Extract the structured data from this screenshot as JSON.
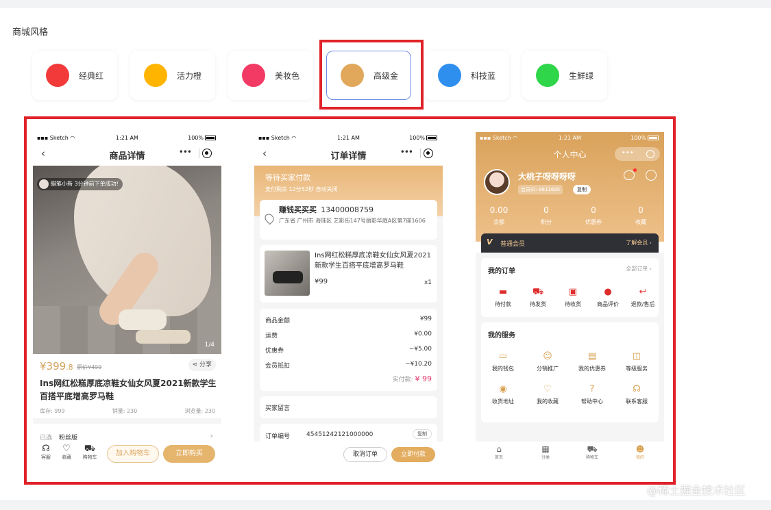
{
  "section_title": "商城风格",
  "themes": [
    {
      "label": "经典红",
      "color": "#f23a3a"
    },
    {
      "label": "活力橙",
      "color": "#ffb400"
    },
    {
      "label": "美妆色",
      "color": "#f23a64"
    },
    {
      "label": "高级金",
      "color": "#e1a85c"
    },
    {
      "label": "科技蓝",
      "color": "#2f8fef"
    },
    {
      "label": "生鲜绿",
      "color": "#2fd64a"
    }
  ],
  "status_bar": {
    "carrier": "▪▪▪ Sketch ◠",
    "time": "1:21 AM",
    "battery": "100%"
  },
  "product": {
    "nav_title": "商品详情",
    "toast": "蜡笔小新 3分钟前下单成功!",
    "pager": "1/4",
    "price_int": "¥399",
    "price_dec": ".8",
    "old_price": "原价¥499",
    "share": "分享",
    "title": "Ins网红松糕厚底凉鞋女仙女风夏2021新款学生百搭平底增高罗马鞋",
    "stock": "库存: 999",
    "sales": "销量: 230",
    "views": "浏览量: 230",
    "selected_label": "已选",
    "selected_value": "粉丝版",
    "tabs": [
      "客服",
      "收藏",
      "购物车"
    ],
    "add_cart": "加入购物车",
    "buy_now": "立即购买"
  },
  "order": {
    "nav_title": "订单详情",
    "status": "等待买家付款",
    "countdown": "支付剩余 12分52秒 自动关闭",
    "name": "赚钱买买买",
    "phone": "13400008759",
    "address": "广东省 广州市 海珠区 艺影街147号丽影华庭A区第7座1606",
    "goods_title": "Ins网红松糕厚底凉鞋女仙女风夏2021新款学生百搭平底增高罗马鞋",
    "goods_price": "¥99",
    "goods_qty": "x1",
    "rows": [
      {
        "k": "商品金额",
        "v": "¥99"
      },
      {
        "k": "运费",
        "v": "¥0.00"
      },
      {
        "k": "优惠券",
        "v": "−¥5.00"
      },
      {
        "k": "会员抵扣",
        "v": "−¥10.20"
      }
    ],
    "real_pay_label": "实付款:",
    "real_pay_value": "¥ 99",
    "message_label": "买家留言",
    "order_no_label": "订单编号",
    "order_no": "45451242121000000",
    "copy": "复制",
    "cancel": "取消订单",
    "pay": "立即付款"
  },
  "profile": {
    "nav_title": "个人中心",
    "username": "大桃子呀呀呀呀",
    "uid": "会员ID: 8611695",
    "copy": "复制",
    "stats": [
      {
        "v": "0.00",
        "k": "余额"
      },
      {
        "v": "0",
        "k": "积分"
      },
      {
        "v": "0",
        "k": "优惠券"
      },
      {
        "v": "0",
        "k": "收藏"
      }
    ],
    "vip_badge": "V",
    "vip_label": "普通会员",
    "vip_link": "了解会员 ›",
    "orders_title": "我的订单",
    "orders_all": "全部订单 ›",
    "orders": [
      "待付款",
      "待发货",
      "待收货",
      "商品评价",
      "退款/售后"
    ],
    "services_title": "我的服务",
    "services": [
      "我的钱包",
      "分销推广",
      "我的优惠券",
      "等级服务",
      "收货地址",
      "我的收藏",
      "帮助中心",
      "联系客服"
    ],
    "tabs": [
      "首页",
      "分类",
      "购物车",
      "我的"
    ]
  },
  "watermark": "@稀土掘金技术社区"
}
